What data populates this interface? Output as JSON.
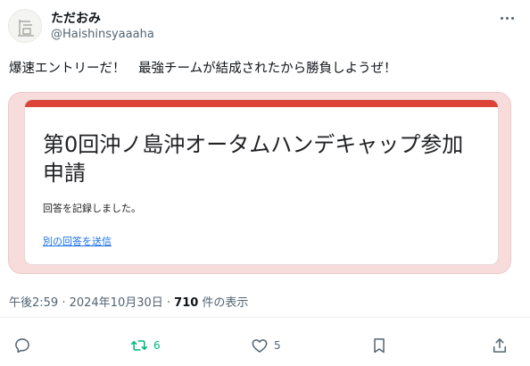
{
  "author": {
    "display_name": "ただおみ",
    "handle": "@Haishinsyaaaha"
  },
  "tweet": {
    "text": "爆速エントリーだ！　最強チームが結成されたから勝負しようぜ！"
  },
  "card": {
    "title": "第0回沖ノ島沖オータムハンデキャップ参加申請",
    "message": "回答を記録しました。",
    "link": "別の回答を送信",
    "accent_color": "#db4437"
  },
  "meta": {
    "timestamp": "午後2:59 · 2024年10月30日 · ",
    "views_count": "710",
    "views_label": " 件の表示"
  },
  "actions": {
    "reply": {
      "icon": "reply-icon",
      "count": ""
    },
    "retweet": {
      "icon": "retweet-icon",
      "count": "6",
      "color": "#00ba7c"
    },
    "like": {
      "icon": "heart-icon",
      "count": "5"
    },
    "bookmark": {
      "icon": "bookmark-icon"
    },
    "share": {
      "icon": "share-icon"
    }
  }
}
